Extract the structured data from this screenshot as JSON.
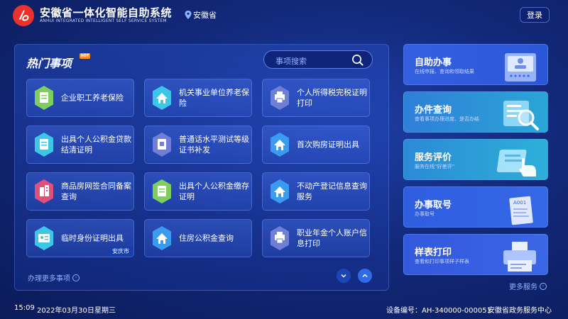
{
  "header": {
    "title": "安徽省一体化智能自助系统",
    "subtitle": "ANHUI INTEGRATED INTELLIGENT SELF SERVICE SYSTEM",
    "location": "安徽省",
    "login_label": "登录",
    "logo_icon": "logo-icon",
    "brand_color": "#e8322b"
  },
  "panel": {
    "title": "热门事项",
    "hot_badge": "HOT",
    "search_placeholder": "事项搜索",
    "more_label": "办理更多事项",
    "tiles": [
      {
        "label": "企业职工养老保险",
        "icon": "document-icon",
        "color": "#7ccf5a"
      },
      {
        "label": "机关事业单位养老保险",
        "icon": "house-icon",
        "color": "#3cc6e8"
      },
      {
        "label": "个人所得税完税证明打印",
        "icon": "printer-icon",
        "color": "#6f7fd8"
      },
      {
        "label": "出具个人公积金贷款结清证明",
        "icon": "document-icon",
        "color": "#3cc6e8"
      },
      {
        "label": "普通话水平测试等级证书补发",
        "icon": "book-icon",
        "color": "#6f7fd8"
      },
      {
        "label": "首次购房证明出具",
        "icon": "house-icon",
        "color": "#3a9cf0"
      },
      {
        "label": "商品房网签合同备案查询",
        "icon": "building-icon",
        "color": "#e0507a"
      },
      {
        "label": "出具个人公积金缴存证明",
        "icon": "document-icon",
        "color": "#7ccf5a"
      },
      {
        "label": "不动产登记信息查询服务",
        "icon": "house-icon",
        "color": "#3a9cf0"
      },
      {
        "label": "临时身份证明出具",
        "icon": "id-card-icon",
        "color": "#3cc6e8",
        "badge": "安庆市"
      },
      {
        "label": "住房公积金查询",
        "icon": "house-icon",
        "color": "#3a9cf0"
      },
      {
        "label": "职业年金个人账户信息打印",
        "icon": "printer-icon",
        "color": "#6f7fd8"
      }
    ]
  },
  "services": [
    {
      "title": "自助办事",
      "subtitle": "在线申报、查询和领取结果",
      "icon": "kiosk-icon"
    },
    {
      "title": "办件查询",
      "subtitle": "查看事项办理进度、是否办结",
      "icon": "magnifier-icon"
    },
    {
      "title": "服务评价",
      "subtitle": "服务在线“好差评”",
      "icon": "hand-pointer-icon"
    },
    {
      "title": "办事取号",
      "subtitle": "办事取号",
      "icon": "ticket-icon",
      "ticket_text": "A001"
    },
    {
      "title": "样表打印",
      "subtitle": "查看和打印事项样子样表",
      "icon": "printer-icon"
    }
  ],
  "more_services_label": "更多服务",
  "footer": {
    "time": "15:09",
    "date": "2022年03月30日",
    "weekday": "星期三",
    "device_label": "设备编号：AH-340000-000051",
    "center": "安徽省政务服务中心"
  }
}
